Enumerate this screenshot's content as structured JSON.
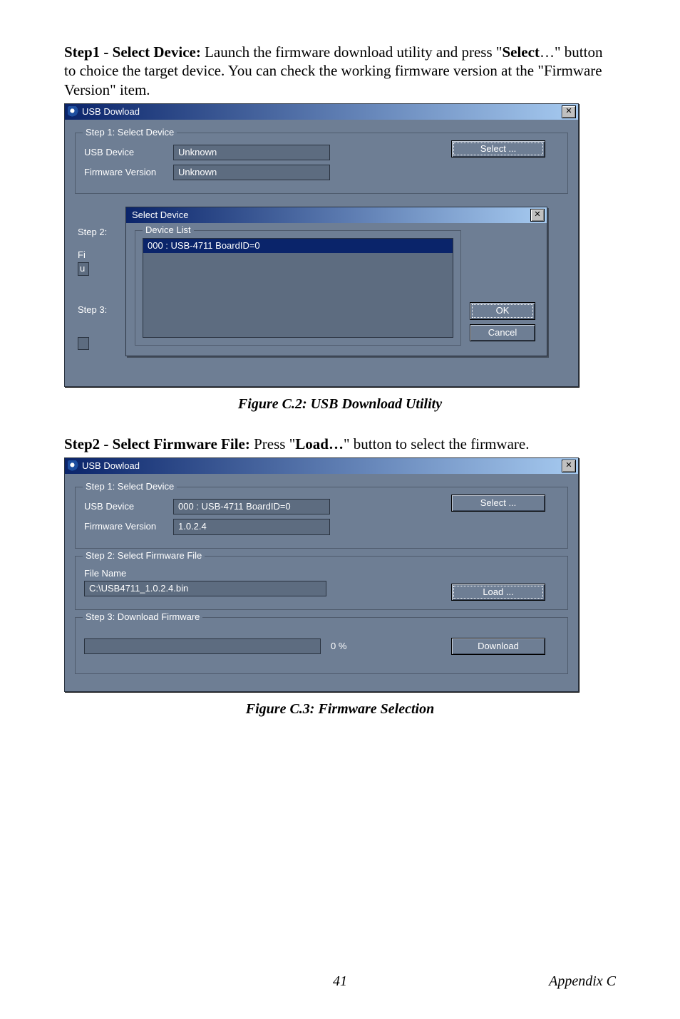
{
  "step1_intro": {
    "bold1": "Step1 - Select Device:",
    "text1": " Launch the firmware download utility and press \"",
    "bold2": "Select",
    "text2": "…\" button to choice the target device. You can check the working firmware version at the \"Firmware Version\" item."
  },
  "fig1_caption": "Figure C.2: USB Download Utility",
  "dialog1": {
    "title": "USB Dowload",
    "close_glyph": "✕",
    "group1_legend": "Step 1: Select Device",
    "usb_device_label": "USB Device",
    "usb_device_value": "Unknown",
    "fw_version_label": "Firmware Version",
    "fw_version_value": "Unknown",
    "select_button": "Select ...",
    "group2_label": "Step 2:",
    "fi_label": "Fi",
    "u_label": "u",
    "group3_label": "Step 3:",
    "child": {
      "title": "Select Device",
      "list_legend": "Device List",
      "list_item0": "000 : USB-4711 BoardID=0",
      "ok": "OK",
      "cancel": "Cancel",
      "close_glyph": "✕"
    }
  },
  "step2_intro": {
    "bold1": "Step2 - Select Firmware File:",
    "text1": " Press \"",
    "bold2": "Load…",
    "text2": "\" button to select the firmware."
  },
  "dialog2": {
    "title": "USB Dowload",
    "close_glyph": "✕",
    "group1_legend": "Step 1: Select Device",
    "usb_device_label": "USB Device",
    "usb_device_value": "000 : USB-4711 BoardID=0",
    "fw_version_label": "Firmware Version",
    "fw_version_value": "1.0.2.4",
    "select_button": "Select ...",
    "group2_legend": "Step 2: Select Firmware File",
    "file_name_label": "File Name",
    "file_name_value": "C:\\USB4711_1.0.2.4.bin",
    "load_button": "Load ...",
    "group3_legend": "Step 3: Download Firmware",
    "progress_pct": "0 %",
    "download_button": "Download"
  },
  "fig2_caption": "Figure C.3: Firmware Selection",
  "footer": {
    "page": "41",
    "section": "Appendix C"
  }
}
